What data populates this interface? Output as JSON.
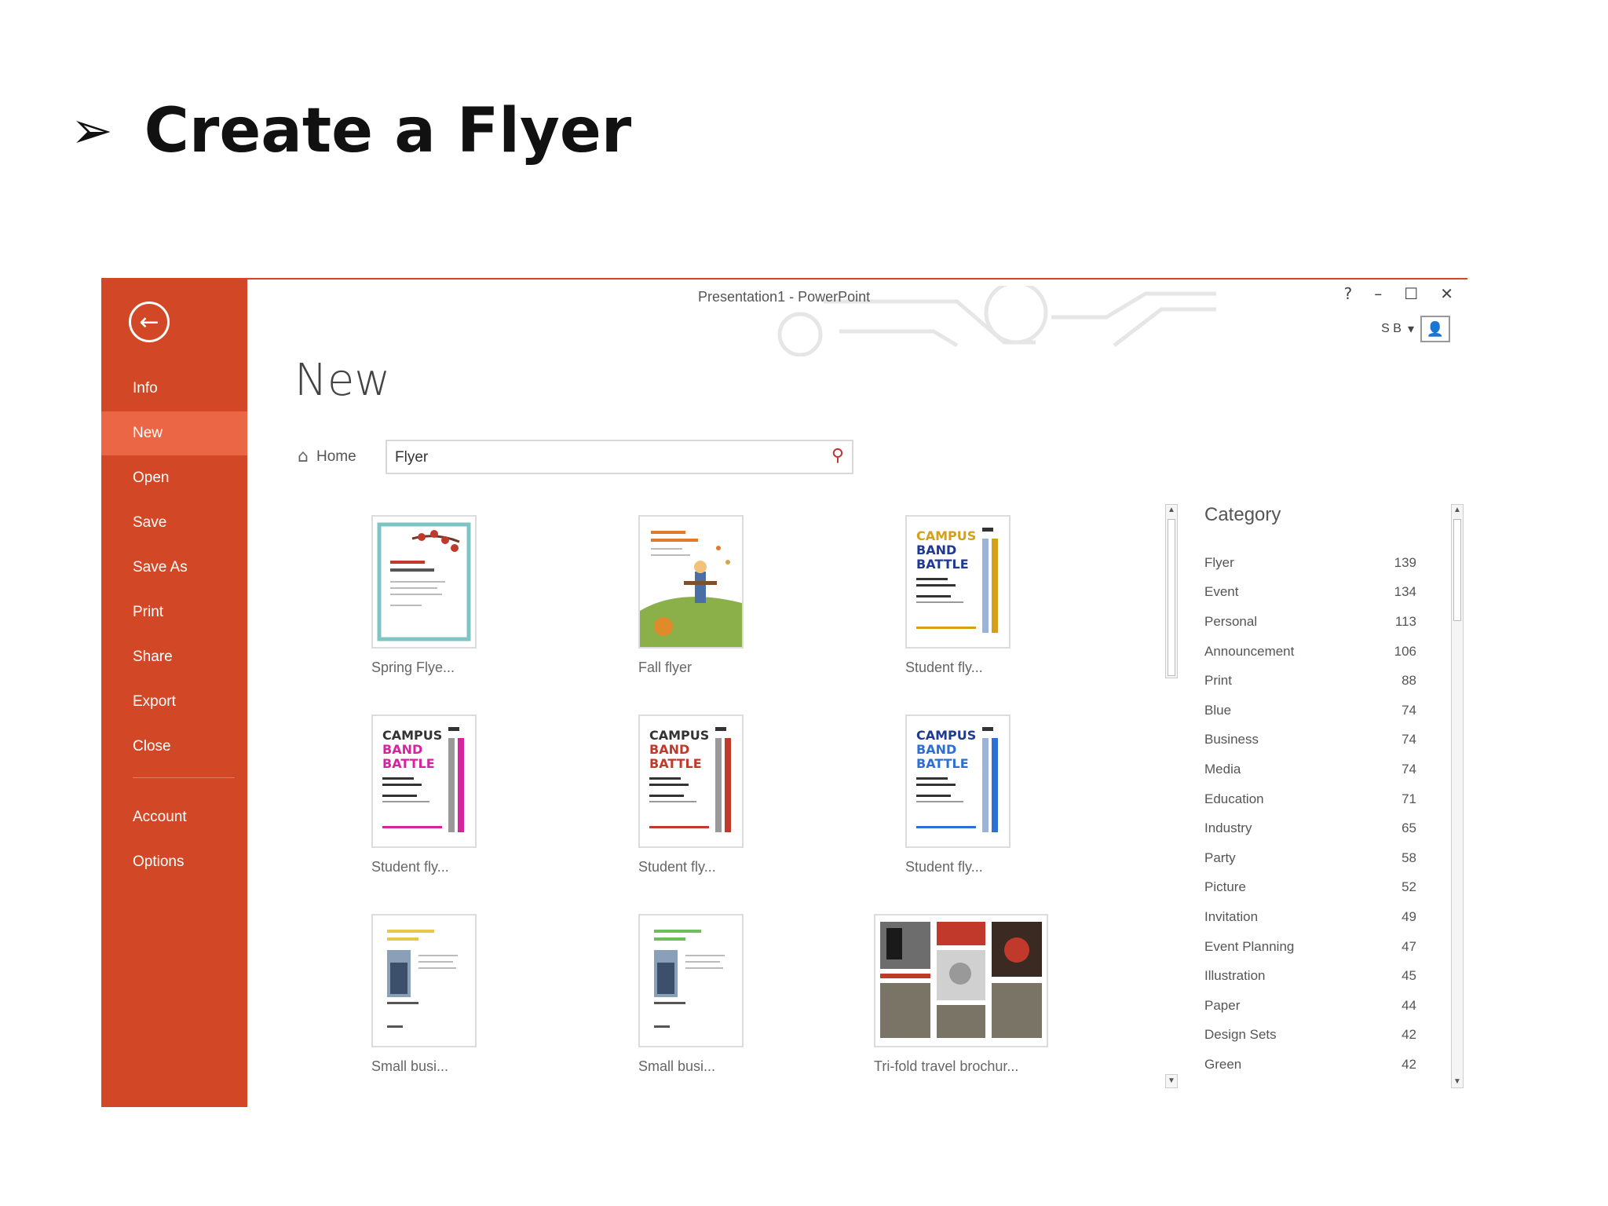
{
  "slide": {
    "bullet": "➢",
    "title": "Create a Flyer"
  },
  "titlebar": {
    "title": "Presentation1 - PowerPoint",
    "help": "?",
    "minimize": "–",
    "restore": "☐",
    "close": "✕",
    "user_initials": "S B",
    "user_caret": "▾"
  },
  "backstage": {
    "back_icon": "←",
    "items": [
      {
        "label": "Info"
      },
      {
        "label": "New"
      },
      {
        "label": "Open"
      },
      {
        "label": "Save"
      },
      {
        "label": "Save As"
      },
      {
        "label": "Print"
      },
      {
        "label": "Share"
      },
      {
        "label": "Export"
      },
      {
        "label": "Close"
      },
      {
        "label": "Account"
      },
      {
        "label": "Options"
      }
    ]
  },
  "main": {
    "heading": "New",
    "home_label": "Home",
    "search_value": "Flyer",
    "search_icon": "⚲",
    "templates": [
      {
        "label": "Spring Flye..."
      },
      {
        "label": "Fall flyer"
      },
      {
        "label": "Student fly..."
      },
      {
        "label": "Student fly..."
      },
      {
        "label": "Student fly..."
      },
      {
        "label": "Student fly..."
      },
      {
        "label": "Small busi..."
      },
      {
        "label": "Small busi..."
      },
      {
        "label": "Tri-fold travel brochur..."
      }
    ],
    "campus_lines": [
      "CAMPUS",
      "BAND",
      "BATTLE"
    ]
  },
  "category": {
    "title": "Category",
    "items": [
      {
        "name": "Flyer",
        "count": "139"
      },
      {
        "name": "Event",
        "count": "134"
      },
      {
        "name": "Personal",
        "count": "113"
      },
      {
        "name": "Announcement",
        "count": "106"
      },
      {
        "name": "Print",
        "count": "88"
      },
      {
        "name": "Blue",
        "count": "74"
      },
      {
        "name": "Business",
        "count": "74"
      },
      {
        "name": "Media",
        "count": "74"
      },
      {
        "name": "Education",
        "count": "71"
      },
      {
        "name": "Industry",
        "count": "65"
      },
      {
        "name": "Party",
        "count": "58"
      },
      {
        "name": "Picture",
        "count": "52"
      },
      {
        "name": "Invitation",
        "count": "49"
      },
      {
        "name": "Event Planning",
        "count": "47"
      },
      {
        "name": "Illustration",
        "count": "45"
      },
      {
        "name": "Paper",
        "count": "44"
      },
      {
        "name": "Design Sets",
        "count": "42"
      },
      {
        "name": "Green",
        "count": "42"
      }
    ]
  },
  "colors": {
    "accent": "#d24726",
    "accent_active": "#ea6644"
  }
}
